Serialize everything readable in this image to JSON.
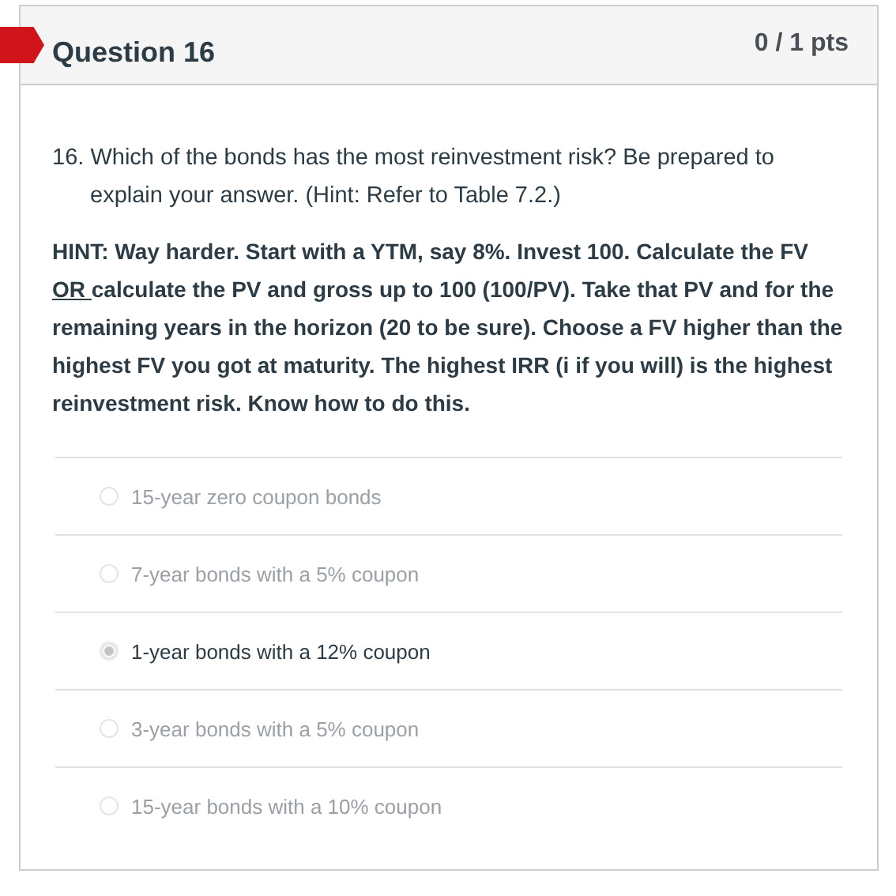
{
  "question": {
    "title": "Question 16",
    "points": "0 / 1 pts",
    "incorrect": true,
    "number": "16.",
    "text": "Which of the bonds has the most reinvestment risk? Be prepared to explain your answer. (Hint: Refer to Table 7.2.)",
    "hint": [
      {
        "text": "HINT: Way harder. Start with a YTM, say 8%. Invest 100. Calculate the FV ",
        "underline": false
      },
      {
        "text": "OR ",
        "underline": true
      },
      {
        "text": "calculate the PV and gross up to 100 (100/PV). Take that PV and for the remaining years in the horizon (20 to be sure). Choose a FV higher than the highest FV you got at maturity. The highest IRR (i if you will) is the highest reinvestment risk. Know how to do this.",
        "underline": false
      }
    ],
    "answers": [
      {
        "label": "15-year zero coupon bonds",
        "selected": false
      },
      {
        "label": "7-year bonds with a 5% coupon",
        "selected": false
      },
      {
        "label": "1-year bonds with a 12% coupon",
        "selected": true
      },
      {
        "label": "3-year bonds with a 5% coupon",
        "selected": false
      },
      {
        "label": "15-year bonds with a 10% coupon",
        "selected": false
      }
    ]
  }
}
